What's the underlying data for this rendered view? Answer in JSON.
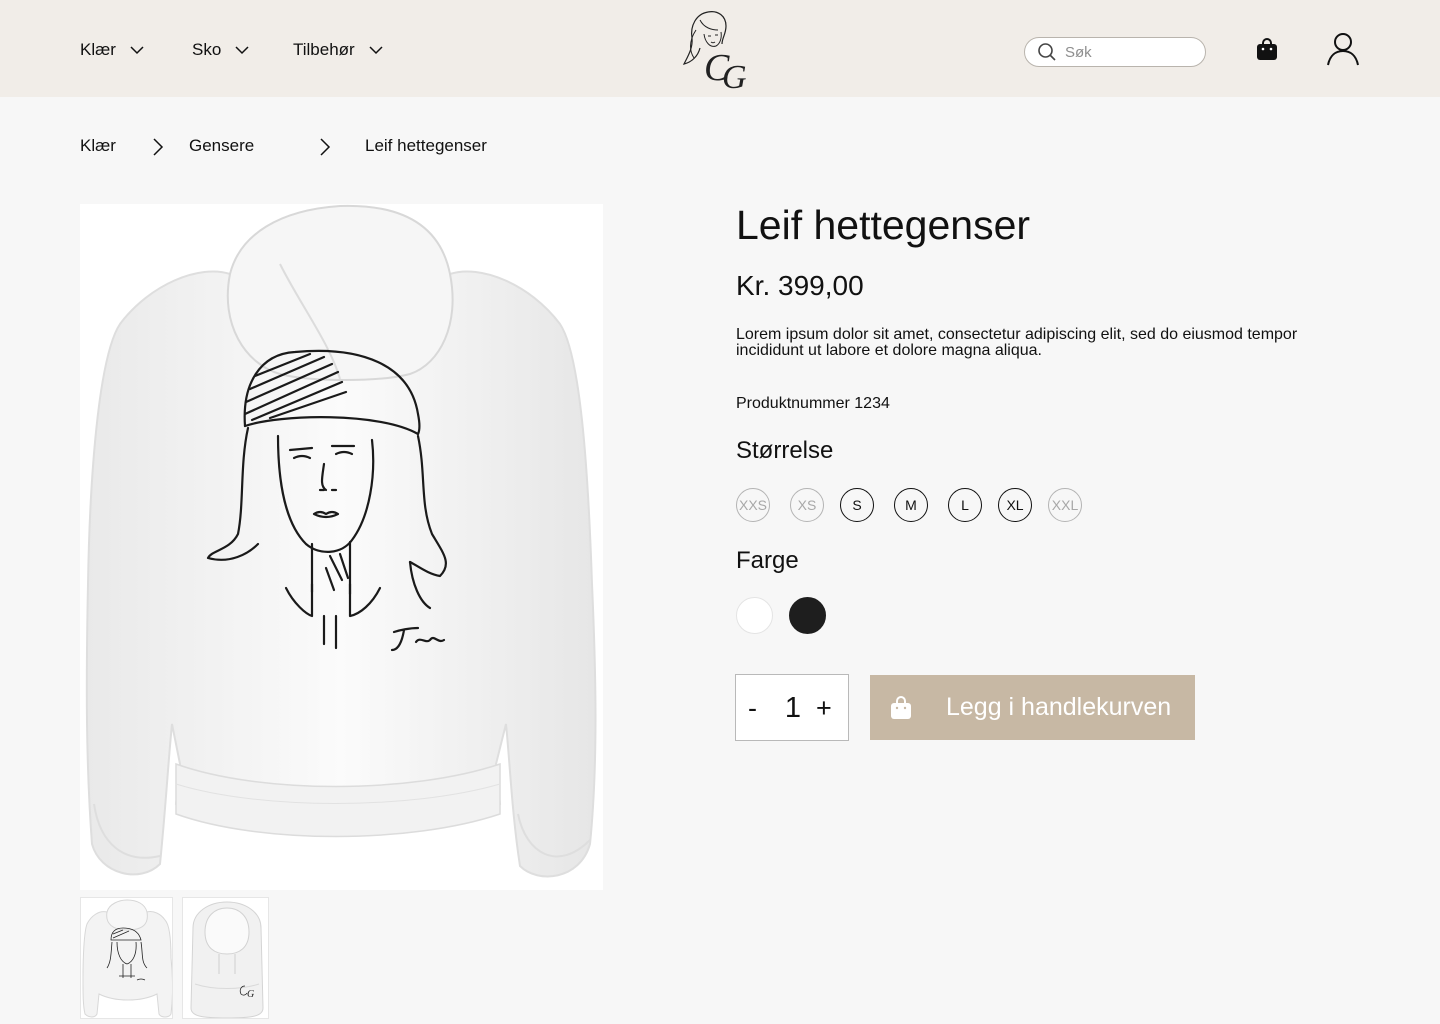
{
  "header": {
    "nav": [
      {
        "label": "Klær"
      },
      {
        "label": "Sko"
      },
      {
        "label": "Tilbehør"
      }
    ],
    "search_placeholder": "Søk",
    "icons": {
      "search": "search-icon",
      "cart": "shopping-bag-icon",
      "account": "user-icon",
      "logo": "cg-logo"
    },
    "background": "#f1ede8"
  },
  "breadcrumb": [
    "Klær",
    "Gensere",
    "Leif hettegenser"
  ],
  "product": {
    "title": "Leif hettegenser",
    "price": "Kr. 399,00",
    "description": "Lorem ipsum dolor sit amet, consectetur adipiscing elit, sed do eiusmod tempor incididunt ut labore et dolore magna aliqua.",
    "product_number": "Produktnummer 1234",
    "size_heading": "Størrelse",
    "sizes": [
      {
        "label": "XXS",
        "available": false
      },
      {
        "label": "XS",
        "available": false
      },
      {
        "label": "S",
        "available": true
      },
      {
        "label": "M",
        "available": true
      },
      {
        "label": "L",
        "available": true
      },
      {
        "label": "XL",
        "available": true
      },
      {
        "label": "XXL",
        "available": false
      }
    ],
    "color_heading": "Farge",
    "colors": [
      {
        "name": "white",
        "hex": "#ffffff"
      },
      {
        "name": "black",
        "hex": "#1e1e1e"
      }
    ],
    "quantity": {
      "minus": "-",
      "value": "1",
      "plus": "+"
    },
    "add_to_cart": "Legg i handlekurven",
    "accent": "#c7b8a4"
  }
}
